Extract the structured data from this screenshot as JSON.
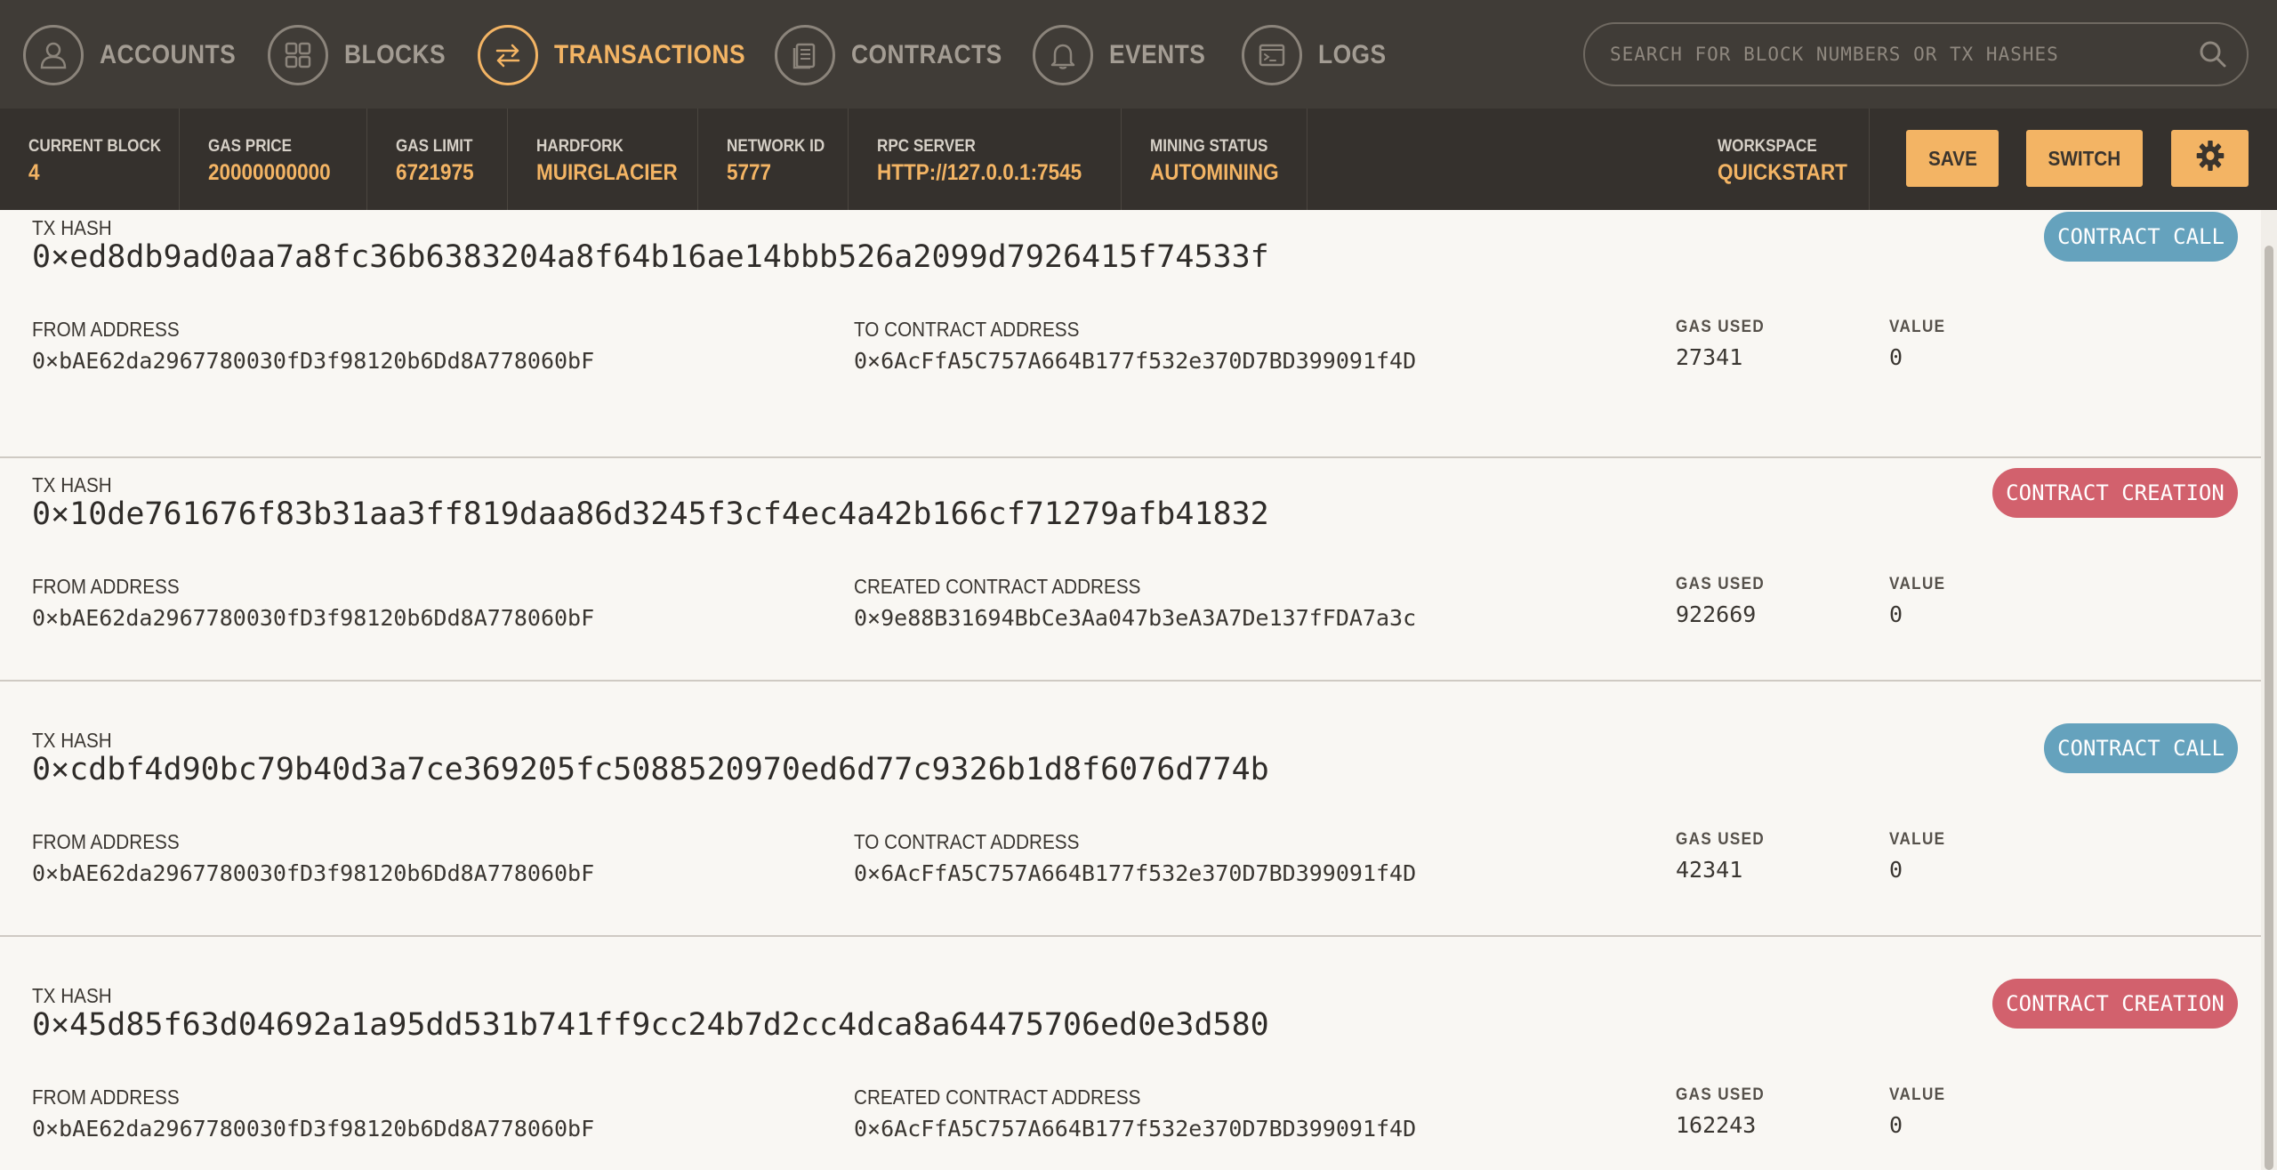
{
  "nav": {
    "items": [
      {
        "label": "ACCOUNTS",
        "icon": "person-icon"
      },
      {
        "label": "BLOCKS",
        "icon": "grid-icon"
      },
      {
        "label": "TRANSACTIONS",
        "icon": "swap-arrows-icon",
        "active": true
      },
      {
        "label": "CONTRACTS",
        "icon": "document-icon"
      },
      {
        "label": "EVENTS",
        "icon": "bell-icon"
      },
      {
        "label": "LOGS",
        "icon": "terminal-icon"
      }
    ],
    "search_placeholder": "SEARCH FOR BLOCK NUMBERS OR TX HASHES"
  },
  "status": {
    "current_block": {
      "label": "CURRENT BLOCK",
      "value": "4"
    },
    "gas_price": {
      "label": "GAS PRICE",
      "value": "20000000000"
    },
    "gas_limit": {
      "label": "GAS LIMIT",
      "value": "6721975"
    },
    "hardfork": {
      "label": "HARDFORK",
      "value": "MUIRGLACIER"
    },
    "network_id": {
      "label": "NETWORK ID",
      "value": "5777"
    },
    "rpc_server": {
      "label": "RPC SERVER",
      "value": "HTTP://127.0.0.1:7545"
    },
    "mining_status": {
      "label": "MINING STATUS",
      "value": "AUTOMINING"
    },
    "workspace": {
      "label": "WORKSPACE",
      "value": "QUICKSTART"
    },
    "save_label": "SAVE",
    "switch_label": "SWITCH"
  },
  "labels": {
    "tx_hash": "TX HASH",
    "from_address": "FROM ADDRESS",
    "gas_used": "GAS USED",
    "value": "VALUE"
  },
  "transactions": [
    {
      "hash": "0×ed8db9ad0aa7a8fc36b6383204a8f64b16ae14bbb526a2099d7926415f74533f",
      "from": "0×bAE62da2967780030fD3f98120b6Dd8A778060bF",
      "to_label": "TO CONTRACT ADDRESS",
      "to": "0×6AcFfA5C757A664B177f532e370D7BD399091f4D",
      "gas_used": "27341",
      "value": "0",
      "type": "CONTRACT CALL"
    },
    {
      "hash": "0×10de761676f83b31aa3ff819daa86d3245f3cf4ec4a42b166cf71279afb41832",
      "from": "0×bAE62da2967780030fD3f98120b6Dd8A778060bF",
      "to_label": "CREATED CONTRACT ADDRESS",
      "to": "0×9e88B31694BbCe3Aa047b3eA3A7De137fFDA7a3c",
      "gas_used": "922669",
      "value": "0",
      "type": "CONTRACT CREATION"
    },
    {
      "hash": "0×cdbf4d90bc79b40d3a7ce369205fc5088520970ed6d77c9326b1d8f6076d774b",
      "from": "0×bAE62da2967780030fD3f98120b6Dd8A778060bF",
      "to_label": "TO CONTRACT ADDRESS",
      "to": "0×6AcFfA5C757A664B177f532e370D7BD399091f4D",
      "gas_used": "42341",
      "value": "0",
      "type": "CONTRACT CALL"
    },
    {
      "hash": "0×45d85f63d04692a1a95dd531b741ff9cc24b7d2cc4dca8a64475706ed0e3d580",
      "from": "0×bAE62da2967780030fD3f98120b6Dd8A778060bF",
      "to_label": "CREATED CONTRACT ADDRESS",
      "to": "0×6AcFfA5C757A664B177f532e370D7BD399091f4D",
      "gas_used": "162243",
      "value": "0",
      "type": "CONTRACT CREATION"
    }
  ],
  "colors": {
    "nav_bg": "#403c37",
    "status_bg": "#35312d",
    "accent": "#f3b464",
    "contract_call": "#65a2bd",
    "contract_creation": "#d2616d"
  }
}
